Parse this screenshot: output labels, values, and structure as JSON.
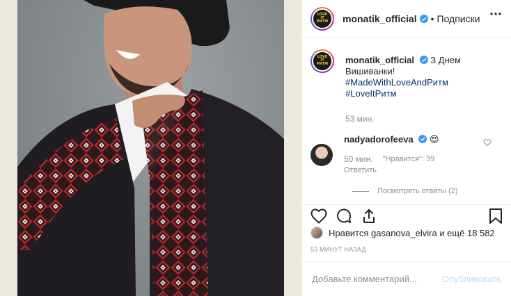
{
  "post": {
    "author": "monatik_official",
    "follow_label": "Подписки",
    "separator": "•",
    "caption_text": "З Днем Вишиванки!",
    "hashtags": [
      "#MadeWithLoveAndРитм",
      "#LoveItРитм"
    ],
    "caption_time": "53 мин."
  },
  "comment": {
    "author": "nadyadorofeeva",
    "text": "😍",
    "time": "50 мин.",
    "likes_label": "\"Нравится\": 39",
    "reply_label": "Ответить",
    "view_replies": "Посмотреть ответы (2)"
  },
  "likes": {
    "text_prefix": "Нравится",
    "liked_by": "gasanova_elvira",
    "text_mid": "и ещё",
    "count": "18 582"
  },
  "timestamp": "53 МИНУТ НАЗАД",
  "add_comment": {
    "placeholder": "Добавьте комментарий...",
    "publish_label": "Опубликовать"
  },
  "colors": {
    "verified_blue": "#3897f0",
    "hashtag": "#003569",
    "muted": "#8e8e8e",
    "publish_disabled": "#b2dffc",
    "embroidery_red": "#b3262c"
  },
  "icons": [
    "verified-icon",
    "more-options-icon",
    "heart-icon",
    "comment-icon",
    "share-icon",
    "bookmark-icon"
  ]
}
